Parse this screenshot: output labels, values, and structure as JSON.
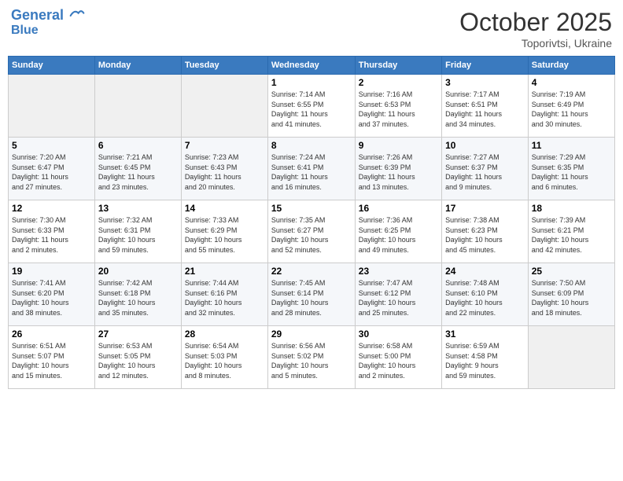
{
  "header": {
    "logo_line1": "General",
    "logo_line2": "Blue",
    "month": "October 2025",
    "location": "Toporivtsi, Ukraine"
  },
  "days_of_week": [
    "Sunday",
    "Monday",
    "Tuesday",
    "Wednesday",
    "Thursday",
    "Friday",
    "Saturday"
  ],
  "weeks": [
    [
      {
        "day": "",
        "info": ""
      },
      {
        "day": "",
        "info": ""
      },
      {
        "day": "",
        "info": ""
      },
      {
        "day": "1",
        "info": "Sunrise: 7:14 AM\nSunset: 6:55 PM\nDaylight: 11 hours\nand 41 minutes."
      },
      {
        "day": "2",
        "info": "Sunrise: 7:16 AM\nSunset: 6:53 PM\nDaylight: 11 hours\nand 37 minutes."
      },
      {
        "day": "3",
        "info": "Sunrise: 7:17 AM\nSunset: 6:51 PM\nDaylight: 11 hours\nand 34 minutes."
      },
      {
        "day": "4",
        "info": "Sunrise: 7:19 AM\nSunset: 6:49 PM\nDaylight: 11 hours\nand 30 minutes."
      }
    ],
    [
      {
        "day": "5",
        "info": "Sunrise: 7:20 AM\nSunset: 6:47 PM\nDaylight: 11 hours\nand 27 minutes."
      },
      {
        "day": "6",
        "info": "Sunrise: 7:21 AM\nSunset: 6:45 PM\nDaylight: 11 hours\nand 23 minutes."
      },
      {
        "day": "7",
        "info": "Sunrise: 7:23 AM\nSunset: 6:43 PM\nDaylight: 11 hours\nand 20 minutes."
      },
      {
        "day": "8",
        "info": "Sunrise: 7:24 AM\nSunset: 6:41 PM\nDaylight: 11 hours\nand 16 minutes."
      },
      {
        "day": "9",
        "info": "Sunrise: 7:26 AM\nSunset: 6:39 PM\nDaylight: 11 hours\nand 13 minutes."
      },
      {
        "day": "10",
        "info": "Sunrise: 7:27 AM\nSunset: 6:37 PM\nDaylight: 11 hours\nand 9 minutes."
      },
      {
        "day": "11",
        "info": "Sunrise: 7:29 AM\nSunset: 6:35 PM\nDaylight: 11 hours\nand 6 minutes."
      }
    ],
    [
      {
        "day": "12",
        "info": "Sunrise: 7:30 AM\nSunset: 6:33 PM\nDaylight: 11 hours\nand 2 minutes."
      },
      {
        "day": "13",
        "info": "Sunrise: 7:32 AM\nSunset: 6:31 PM\nDaylight: 10 hours\nand 59 minutes."
      },
      {
        "day": "14",
        "info": "Sunrise: 7:33 AM\nSunset: 6:29 PM\nDaylight: 10 hours\nand 55 minutes."
      },
      {
        "day": "15",
        "info": "Sunrise: 7:35 AM\nSunset: 6:27 PM\nDaylight: 10 hours\nand 52 minutes."
      },
      {
        "day": "16",
        "info": "Sunrise: 7:36 AM\nSunset: 6:25 PM\nDaylight: 10 hours\nand 49 minutes."
      },
      {
        "day": "17",
        "info": "Sunrise: 7:38 AM\nSunset: 6:23 PM\nDaylight: 10 hours\nand 45 minutes."
      },
      {
        "day": "18",
        "info": "Sunrise: 7:39 AM\nSunset: 6:21 PM\nDaylight: 10 hours\nand 42 minutes."
      }
    ],
    [
      {
        "day": "19",
        "info": "Sunrise: 7:41 AM\nSunset: 6:20 PM\nDaylight: 10 hours\nand 38 minutes."
      },
      {
        "day": "20",
        "info": "Sunrise: 7:42 AM\nSunset: 6:18 PM\nDaylight: 10 hours\nand 35 minutes."
      },
      {
        "day": "21",
        "info": "Sunrise: 7:44 AM\nSunset: 6:16 PM\nDaylight: 10 hours\nand 32 minutes."
      },
      {
        "day": "22",
        "info": "Sunrise: 7:45 AM\nSunset: 6:14 PM\nDaylight: 10 hours\nand 28 minutes."
      },
      {
        "day": "23",
        "info": "Sunrise: 7:47 AM\nSunset: 6:12 PM\nDaylight: 10 hours\nand 25 minutes."
      },
      {
        "day": "24",
        "info": "Sunrise: 7:48 AM\nSunset: 6:10 PM\nDaylight: 10 hours\nand 22 minutes."
      },
      {
        "day": "25",
        "info": "Sunrise: 7:50 AM\nSunset: 6:09 PM\nDaylight: 10 hours\nand 18 minutes."
      }
    ],
    [
      {
        "day": "26",
        "info": "Sunrise: 6:51 AM\nSunset: 5:07 PM\nDaylight: 10 hours\nand 15 minutes."
      },
      {
        "day": "27",
        "info": "Sunrise: 6:53 AM\nSunset: 5:05 PM\nDaylight: 10 hours\nand 12 minutes."
      },
      {
        "day": "28",
        "info": "Sunrise: 6:54 AM\nSunset: 5:03 PM\nDaylight: 10 hours\nand 8 minutes."
      },
      {
        "day": "29",
        "info": "Sunrise: 6:56 AM\nSunset: 5:02 PM\nDaylight: 10 hours\nand 5 minutes."
      },
      {
        "day": "30",
        "info": "Sunrise: 6:58 AM\nSunset: 5:00 PM\nDaylight: 10 hours\nand 2 minutes."
      },
      {
        "day": "31",
        "info": "Sunrise: 6:59 AM\nSunset: 4:58 PM\nDaylight: 9 hours\nand 59 minutes."
      },
      {
        "day": "",
        "info": ""
      }
    ]
  ]
}
